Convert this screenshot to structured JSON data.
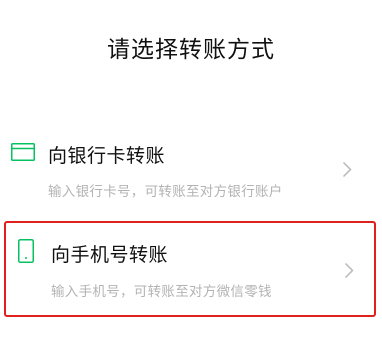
{
  "page": {
    "title": "请选择转账方式"
  },
  "options": [
    {
      "label": "向银行卡转账",
      "description": "输入银行卡号，可转账至对方银行账户",
      "icon": "bank-card-icon"
    },
    {
      "label": "向手机号转账",
      "description": "输入手机号，可转账至对方微信零钱",
      "icon": "mobile-phone-icon",
      "highlighted": true
    }
  ],
  "colors": {
    "accent_green": "#07c160",
    "highlight_border": "#e0201c",
    "secondary_text": "#b3b3b3",
    "chevron": "#b8b8b8"
  }
}
